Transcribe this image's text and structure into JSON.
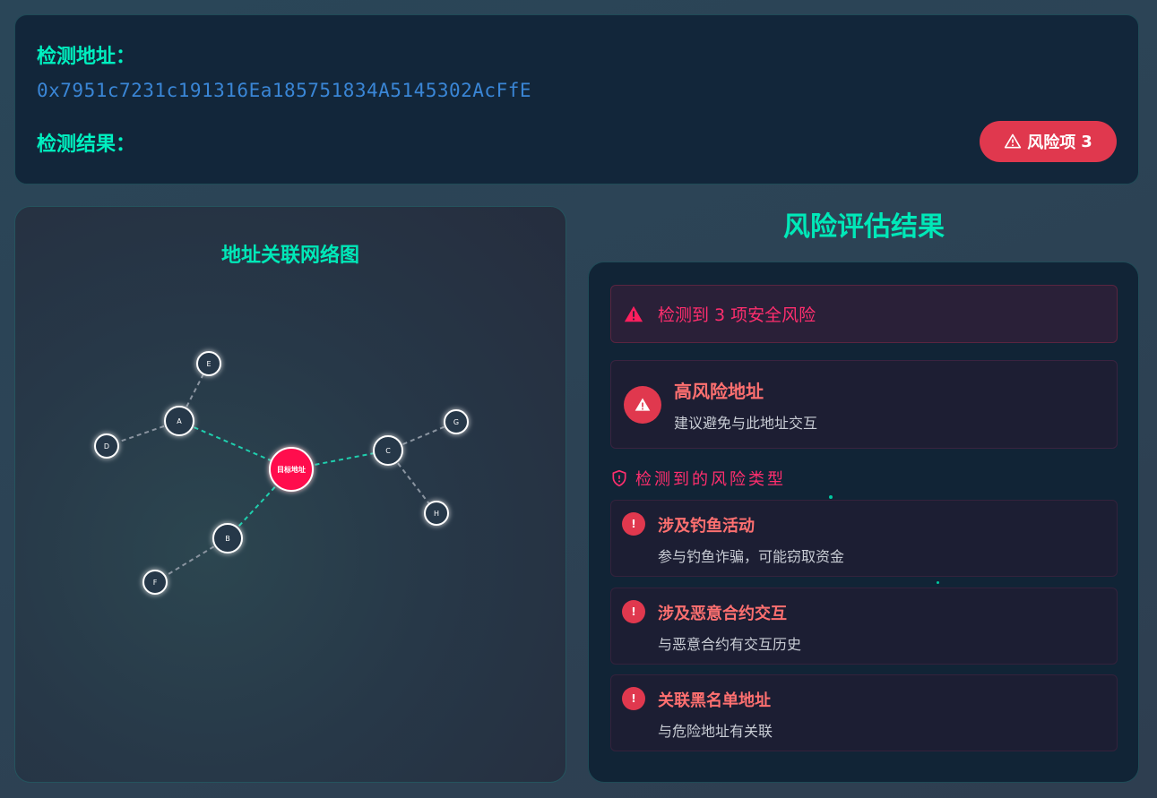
{
  "header": {
    "address_label": "检测地址：",
    "address_value": "0x7951c7231c191316Ea185751834A5145302AcFfE",
    "result_label": "检测结果：",
    "risk_badge": {
      "icon": "warning-triangle-icon",
      "label": "风险项",
      "count": "3"
    }
  },
  "graph": {
    "title": "地址关联网络图",
    "center": "目标地址",
    "nodes": [
      "A",
      "B",
      "C",
      "D",
      "E",
      "F",
      "G",
      "H"
    ]
  },
  "assessment": {
    "title": "风险评估结果",
    "alert": {
      "icon": "warning-triangle-icon",
      "text": "检测到 3 项安全风险"
    },
    "summary": {
      "icon": "warning-triangle-icon",
      "title": "高风险地址",
      "desc": "建议避免与此地址交互"
    },
    "types_heading": {
      "icon": "shield-alert-icon",
      "text": "检测到的风险类型"
    },
    "risks": [
      {
        "icon": "exclamation-icon",
        "title": "涉及钓鱼活动",
        "desc": "参与钓鱼诈骗，可能窃取资金"
      },
      {
        "icon": "exclamation-icon",
        "title": "涉及恶意合约交互",
        "desc": "与恶意合约有交互历史"
      },
      {
        "icon": "exclamation-icon",
        "title": "关联黑名单地址",
        "desc": "与危险地址有关联"
      }
    ]
  },
  "colors": {
    "accent": "#00f0c0",
    "danger": "#e0384e",
    "danger_text": "#ff2e6e",
    "address": "#3a86d6",
    "card": "#12263a"
  }
}
